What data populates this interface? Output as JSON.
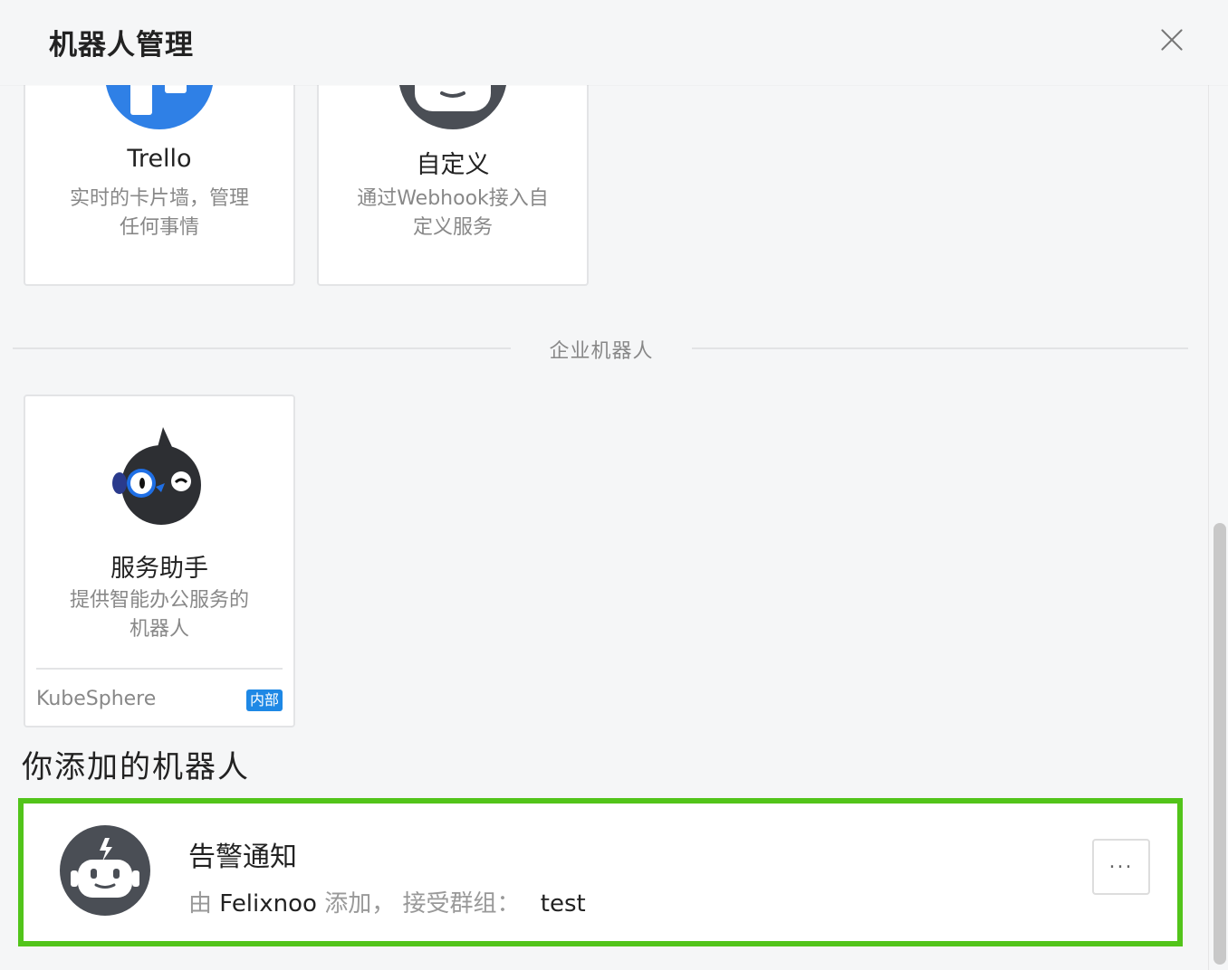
{
  "header": {
    "title": "机器人管理",
    "close_icon": "close-icon"
  },
  "cards": {
    "trello": {
      "title": "Trello",
      "desc_line1": "实时的卡片墙，管理",
      "desc_line2": "任何事情",
      "logo_color": "#2f80e6"
    },
    "custom": {
      "title": "自定义",
      "desc_line1": "通过Webhook接入自",
      "desc_line2": "定义服务",
      "logo_color": "#4a4e55"
    }
  },
  "enterprise_section": {
    "label": "企业机器人"
  },
  "service_card": {
    "title": "服务助手",
    "desc_line1": "提供智能办公服务的",
    "desc_line2": "机器人",
    "provider": "KubeSphere",
    "badge": "内部",
    "badge_color": "#1e88e5"
  },
  "added_section": {
    "title": "你添加的机器人"
  },
  "added_bots": [
    {
      "name": "告警通知",
      "by_prefix": "由",
      "added_by": "Felixnoo",
      "added_suffix": "添加，",
      "group_label": "接受群组：",
      "group": "test",
      "more_label": "...",
      "highlight_color": "#52c41a"
    }
  ]
}
